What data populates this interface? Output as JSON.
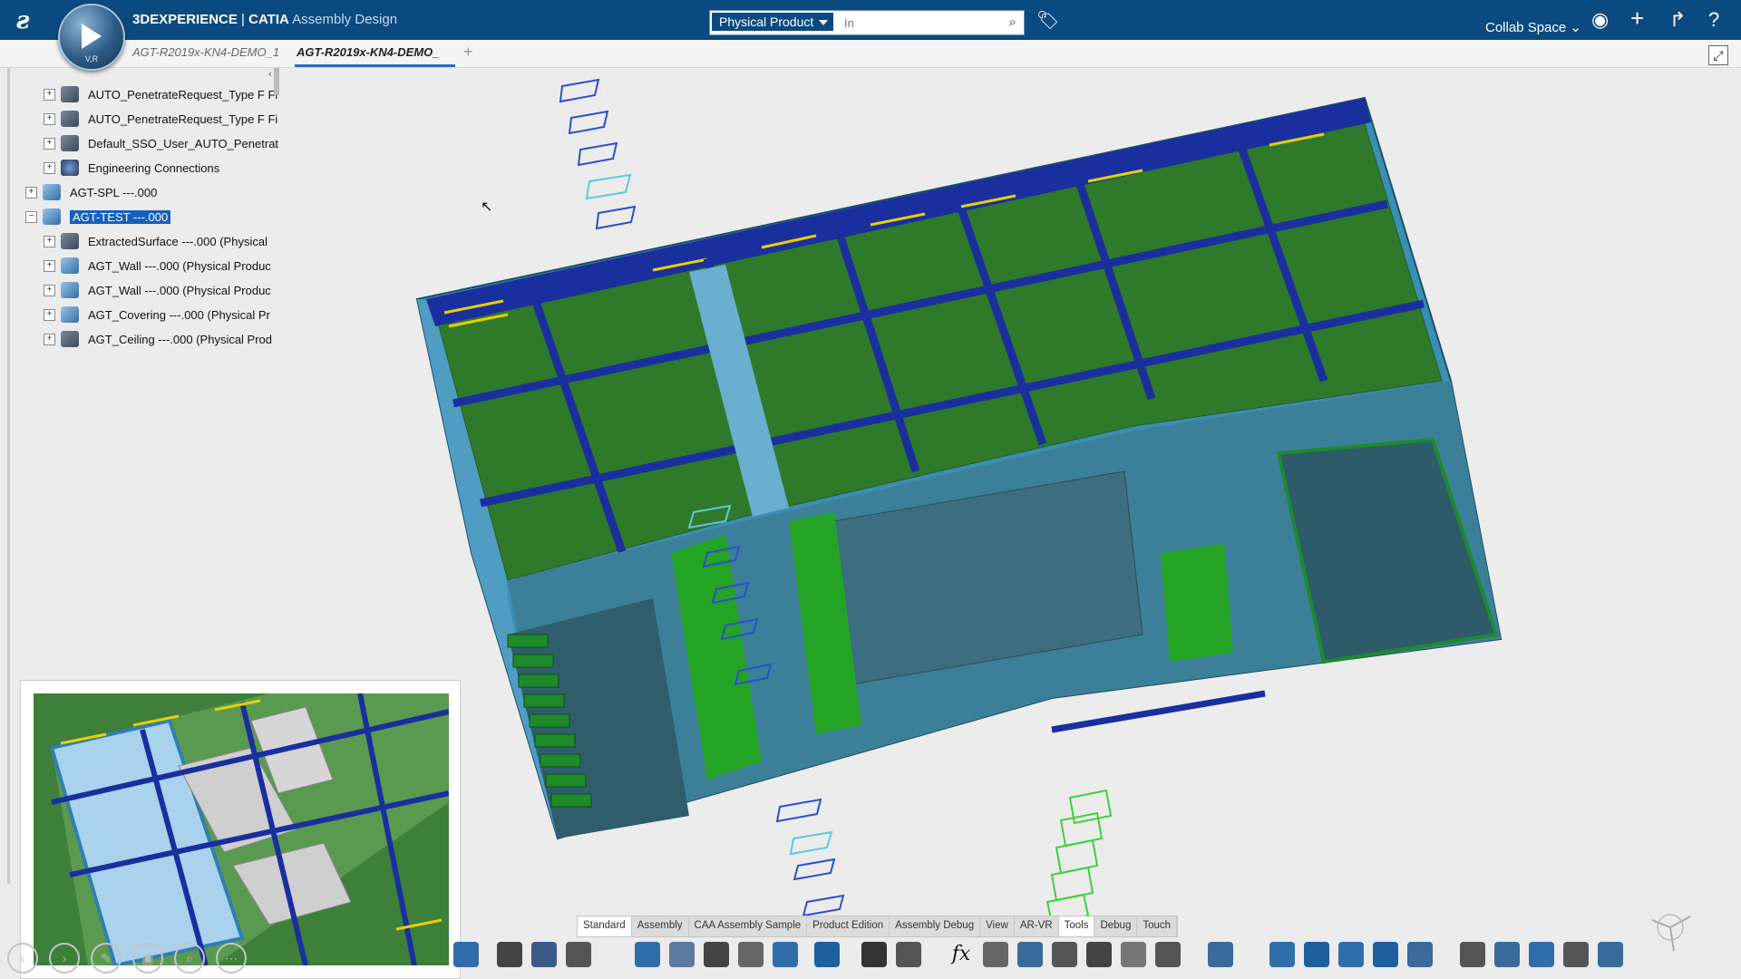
{
  "topbar": {
    "brand_logo": "3DS",
    "compass_label": "V,R",
    "app_brand": "3DEXPERIENCE",
    "app_sep": " | ",
    "app_product": "CATIA",
    "app_module": "Assembly Design",
    "search_scope": "Physical Product",
    "search_placeholder": "In",
    "collab_space": "Collab Space",
    "icons": [
      "search-icon",
      "tag-icon",
      "user-icon",
      "plus-icon",
      "share-icon",
      "help-icon"
    ],
    "bg_color": "#0b4a80"
  },
  "tabs": [
    {
      "label": "AGT-R2019x-KN4-DEMO_1",
      "active": false
    },
    {
      "label": "AGT-R2019x-KN4-DEMO_",
      "active": true
    }
  ],
  "tab_add": "+",
  "tree": {
    "collapse_glyph": "‹",
    "rows": [
      {
        "label": "AUTO_PenetrateRequest_Type F Fi",
        "icon": "part-icon",
        "expander": "+"
      },
      {
        "label": "AUTO_PenetrateRequest_Type F Fi",
        "icon": "part-icon",
        "expander": "+"
      },
      {
        "label": "Default_SSO_User_AUTO_Penetrat",
        "icon": "part-icon",
        "expander": "+"
      },
      {
        "label": "Engineering Connections",
        "icon": "connections-icon",
        "expander": "+"
      },
      {
        "label": "AGT-SPL ---.000",
        "icon": "product-icon",
        "expander": "+"
      },
      {
        "label": "AGT-TEST ---.000",
        "icon": "product-icon",
        "expander": "−",
        "selected": true
      },
      {
        "label": "ExtractedSurface ---.000 (Physical",
        "icon": "part-icon",
        "expander": "+"
      },
      {
        "label": "AGT_Wall ---.000 (Physical Produc",
        "icon": "product-icon",
        "expander": "+"
      },
      {
        "label": "AGT_Wall ---.000 (Physical Produc",
        "icon": "product-icon",
        "expander": "+"
      },
      {
        "label": "AGT_Covering ---.000 (Physical Pr",
        "icon": "product-icon",
        "expander": "+"
      },
      {
        "label": "AGT_Ceiling ---.000 (Physical Prod",
        "icon": "part-icon",
        "expander": "+"
      }
    ]
  },
  "action_bar": {
    "tabs": [
      "Standard",
      "Assembly",
      "CAA Assembly Sample",
      "Product Edition",
      "Assembly Debug",
      "View",
      "AR-VR",
      "Tools",
      "Debug",
      "Touch"
    ],
    "active_tab": "Tools",
    "formula_glyph": "fx"
  },
  "colors": {
    "floor_green": "#2f7a2a",
    "wall_blue": "#3f8fb5",
    "beam_blue": "#1a2f9e",
    "accent_yellow": "#e8d000",
    "selection_blue": "#1560bd"
  }
}
